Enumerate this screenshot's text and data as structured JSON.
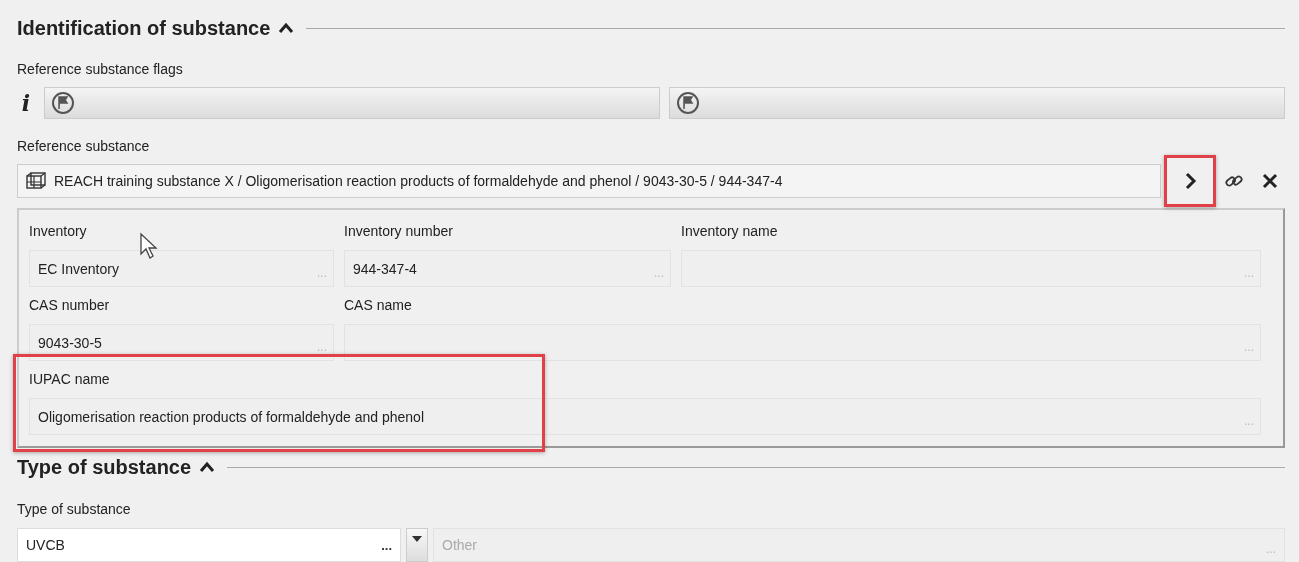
{
  "identification": {
    "title": "Identification of substance",
    "expanded": true,
    "flags": {
      "label": "Reference substance flags",
      "info": "i",
      "fields": [
        {
          "kind": "flag"
        },
        {
          "kind": "flag"
        }
      ]
    },
    "reference": {
      "label": "Reference substance",
      "value": "REACH training substance X / Oligomerisation reaction products of formaldehyde and phenol / 9043-30-5 / 944-347-4",
      "open_highlighted": true
    },
    "details": [
      {
        "kind": "narrow",
        "label": "Inventory",
        "value": "EC Inventory",
        "picker": "...",
        "highlighted": false
      },
      {
        "kind": "narrow",
        "label": "Inventory number",
        "value": "944-347-4",
        "picker": "...",
        "highlighted": false
      },
      {
        "kind": "narrow",
        "label": "Inventory name",
        "picker": "...",
        "highlighted": false
      },
      {
        "kind": "narrow",
        "label": "CAS number",
        "value": "9043-30-5",
        "picker": "...",
        "highlighted": false
      },
      {
        "kind": "double",
        "label": "CAS name",
        "picker": "...",
        "highlighted": false
      },
      {
        "kind": "wide",
        "label": "IUPAC name",
        "value": "Oligomerisation reaction products of formaldehyde and phenol",
        "picker": "...",
        "highlighted": true
      }
    ]
  },
  "type": {
    "title": "Type of substance",
    "expanded": true,
    "field": {
      "label": "Type of substance",
      "value": "UVCB",
      "picker": "...",
      "other_placeholder": "Other",
      "other_picker": "..."
    }
  }
}
